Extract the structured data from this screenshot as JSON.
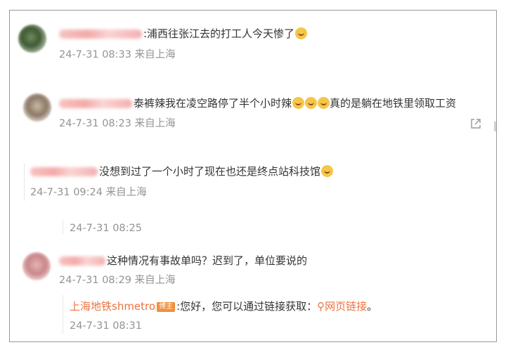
{
  "comments": [
    {
      "text": ":浦西往张江去的打工人今天惨了",
      "emoji": "crying-emoji",
      "time": "24-7-31 08:33",
      "source": "来自上海"
    },
    {
      "text": "泰裤辣我在凌空路停了半个小时辣",
      "emoji_after": "真的是躺在地铁里领取工资",
      "time": "24-7-31 08:23",
      "source": "来自上海"
    },
    {
      "text": "没想到过了一个小时了现在也还是终点站科技馆",
      "time": "24-7-31 09:24",
      "source": "来自上海"
    },
    {
      "time": "24-7-31 08:25"
    },
    {
      "text": "这种情况有事故单吗？迟到了，单位要说的",
      "time": "24-7-31 08:29",
      "source": "来自上海"
    }
  ],
  "reply": {
    "author": "上海地铁shmetro",
    "badge": "博主",
    "text": ":您好，您可以通过链接获取：",
    "link": "网页链接",
    "end": "。",
    "time": "24-7-31 08:31"
  },
  "colors": {
    "accent": "#eb7340",
    "meta": "#939393",
    "text": "#333333"
  }
}
